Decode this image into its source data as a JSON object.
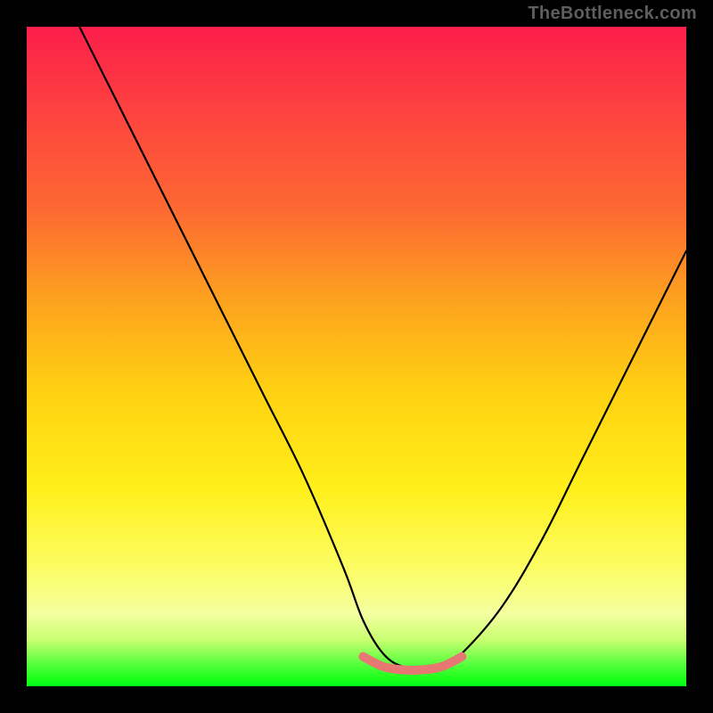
{
  "watermark": "TheBottleneck.com",
  "chart_data": {
    "type": "line",
    "title": "",
    "xlabel": "",
    "ylabel": "",
    "xlim": [
      0,
      100
    ],
    "ylim": [
      0,
      100
    ],
    "grid": false,
    "legend": false,
    "series": [
      {
        "name": "black-curve",
        "color": "#000000",
        "x": [
          8,
          12,
          18,
          24,
          30,
          36,
          42,
          48,
          51,
          54,
          57,
          60,
          63,
          66,
          72,
          78,
          84,
          90,
          96,
          100
        ],
        "y": [
          100,
          92,
          80,
          68,
          56,
          44,
          32,
          18,
          10,
          5,
          3,
          3,
          3,
          5,
          12,
          22,
          34,
          46,
          58,
          66
        ]
      },
      {
        "name": "pink-floor-segment",
        "color": "#e77773",
        "x": [
          51,
          54,
          57,
          60,
          63,
          66
        ],
        "y": [
          4.5,
          3,
          2.5,
          2.5,
          3,
          4.5
        ]
      }
    ],
    "annotations": []
  }
}
